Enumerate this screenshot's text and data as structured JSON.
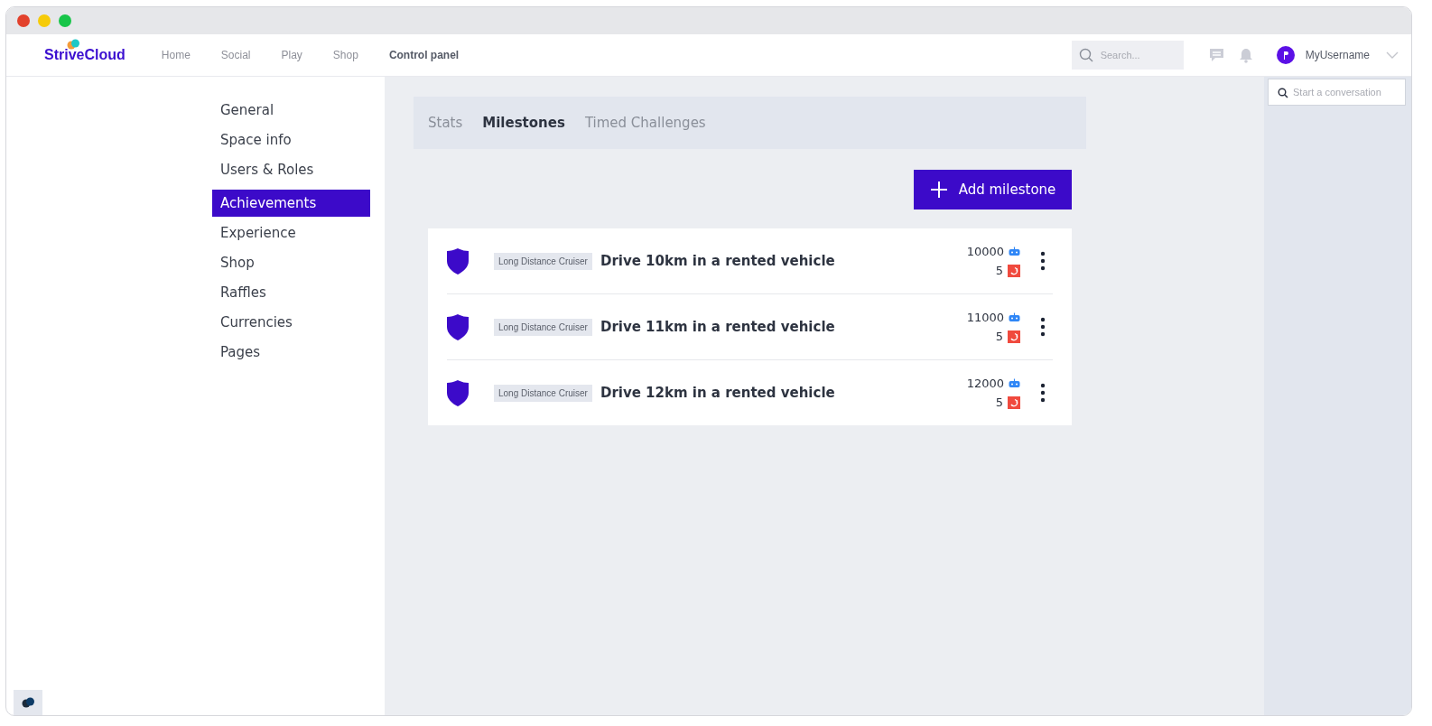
{
  "header": {
    "logo": "StriveCloud",
    "nav": [
      {
        "label": "Home",
        "selected": false
      },
      {
        "label": "Social",
        "selected": false
      },
      {
        "label": "Play",
        "selected": false
      },
      {
        "label": "Shop",
        "selected": false
      },
      {
        "label": "Control panel",
        "selected": true
      }
    ],
    "search": {
      "placeholder": "Search..."
    },
    "username": "MyUsername"
  },
  "sidebar": {
    "items": [
      {
        "label": "General",
        "selected": false
      },
      {
        "label": "Space info",
        "selected": false
      },
      {
        "label": "Users & Roles",
        "selected": false
      },
      {
        "label": "Achievements",
        "selected": true
      },
      {
        "label": "Experience",
        "selected": false
      },
      {
        "label": "Shop",
        "selected": false
      },
      {
        "label": "Raffles",
        "selected": false
      },
      {
        "label": "Currencies",
        "selected": false
      },
      {
        "label": "Pages",
        "selected": false
      }
    ]
  },
  "tabs": [
    {
      "label": "Stats",
      "selected": false
    },
    {
      "label": "Milestones",
      "selected": true
    },
    {
      "label": "Timed Challenges",
      "selected": false
    }
  ],
  "add_button": "Add milestone",
  "milestones": [
    {
      "tag": "Long Distance Cruiser",
      "title": "Drive 10km in a rented vehicle",
      "points": "10000",
      "count": "5"
    },
    {
      "tag": "Long Distance Cruiser",
      "title": "Drive 11km in a rented vehicle",
      "points": "11000",
      "count": "5"
    },
    {
      "tag": "Long Distance Cruiser",
      "title": "Drive 12km in a rented vehicle",
      "points": "12000",
      "count": "5"
    }
  ],
  "chat": {
    "placeholder": "Start a conversation"
  }
}
